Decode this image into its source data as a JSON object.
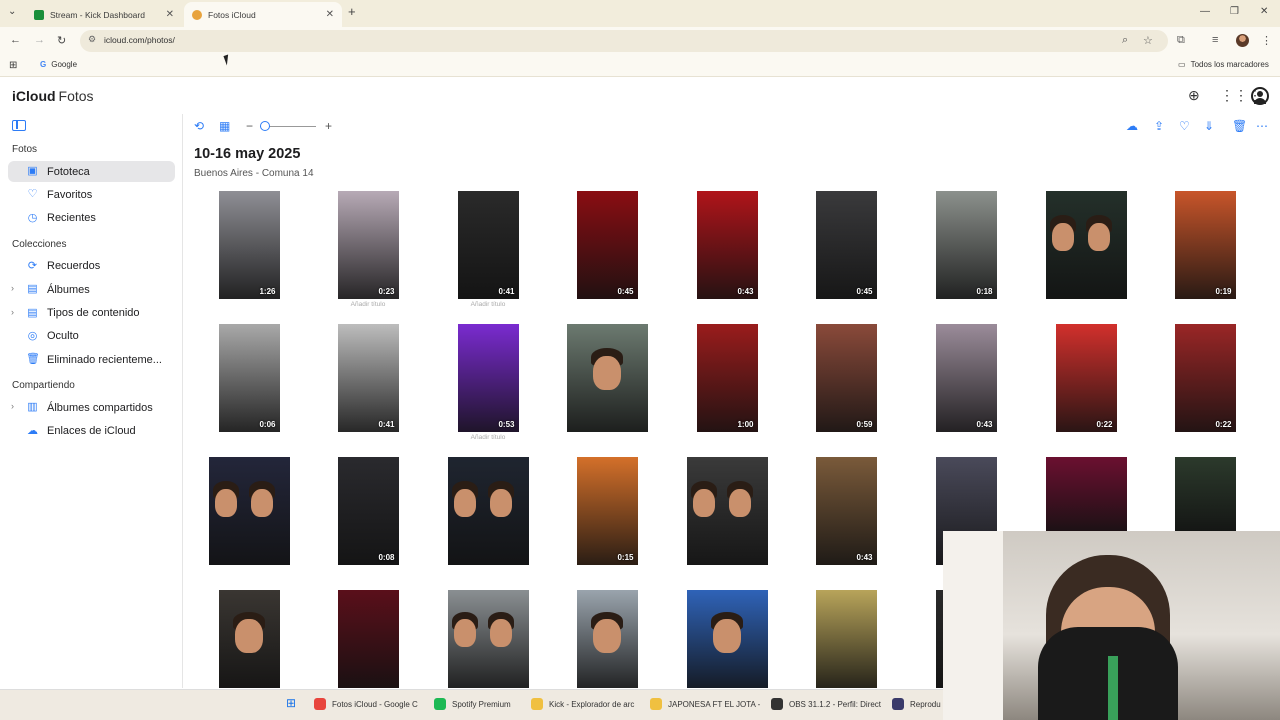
{
  "browser": {
    "tabs": [
      {
        "title": "Stream - Kick Dashboard",
        "favicon_color": "#1a8f3a",
        "active": false
      },
      {
        "title": "Fotos iCloud",
        "favicon_color": "#e8a33d",
        "active": true
      }
    ],
    "new_tab": "+",
    "url": "icloud.com/photos/",
    "bookmarks": {
      "google": "Google",
      "all": "Todos los marcadores"
    }
  },
  "app": {
    "brand": "iCloud",
    "product": "Fotos"
  },
  "sidebar": {
    "sections": [
      {
        "title": "Fotos",
        "items": [
          {
            "label": "Fototeca",
            "icon": "library-icon",
            "selected": true
          },
          {
            "label": "Favoritos",
            "icon": "heart-icon"
          },
          {
            "label": "Recientes",
            "icon": "clock-icon"
          }
        ]
      },
      {
        "title": "Colecciones",
        "items": [
          {
            "label": "Recuerdos",
            "icon": "memories-icon"
          },
          {
            "label": "Álbumes",
            "icon": "album-icon",
            "expandable": true
          },
          {
            "label": "Tipos de contenido",
            "icon": "album-icon",
            "expandable": true
          },
          {
            "label": "Oculto",
            "icon": "eye-off-icon"
          },
          {
            "label": "Eliminado recienteme...",
            "icon": "trash-icon"
          }
        ]
      },
      {
        "title": "Compartiendo",
        "items": [
          {
            "label": "Álbumes compartidos",
            "icon": "shared-album-icon",
            "expandable": true
          },
          {
            "label": "Enlaces de iCloud",
            "icon": "cloud-link-icon"
          }
        ]
      }
    ]
  },
  "main": {
    "date": "10-16 may 2025",
    "place": "Buenos Aires - Comuna 14",
    "add_title": "Añadir título",
    "rows": [
      [
        {
          "dur": "1:26",
          "tone": "#8f8f95"
        },
        {
          "dur": "0:23",
          "tone": "#b7aab6",
          "caption": true
        },
        {
          "dur": "0:41",
          "tone": "#2a2a2a",
          "caption": true
        },
        {
          "dur": "0:45",
          "tone": "#8a0d12"
        },
        {
          "dur": "0:43",
          "tone": "#b0141a"
        },
        {
          "dur": "0:45",
          "tone": "#3a3a3c"
        },
        {
          "dur": "0:18",
          "tone": "#8c918d"
        },
        {
          "dur": "",
          "tone": "#24302a",
          "wide": true,
          "faces": 2
        },
        {
          "dur": "0:19",
          "tone": "#c8552a"
        }
      ],
      [
        {
          "dur": "0:06",
          "tone": "#a9a9a9"
        },
        {
          "dur": "0:41",
          "tone": "#bdbdbd"
        },
        {
          "dur": "0:53",
          "tone": "#7a2bd0",
          "caption": true
        },
        {
          "dur": "",
          "tone": "#6c7a70",
          "wide": true,
          "faces": 1
        },
        {
          "dur": "1:00",
          "tone": "#9a1c1c"
        },
        {
          "dur": "0:59",
          "tone": "#8a4a3a"
        },
        {
          "dur": "0:43",
          "tone": "#9b8c9a"
        },
        {
          "dur": "0:22",
          "tone": "#d2302c"
        },
        {
          "dur": "0:22",
          "tone": "#9a2626"
        }
      ],
      [
        {
          "dur": "",
          "tone": "#23263a",
          "wide": true,
          "faces": 2
        },
        {
          "dur": "0:08",
          "tone": "#2a2a2e"
        },
        {
          "dur": "",
          "tone": "#1f2530",
          "wide": true,
          "faces": 2
        },
        {
          "dur": "0:15",
          "tone": "#d4702a"
        },
        {
          "dur": "",
          "tone": "#3a3a3a",
          "wide": true,
          "faces": 2
        },
        {
          "dur": "0:43",
          "tone": "#7a5a3a"
        },
        {
          "dur": "",
          "tone": "#4a4a5a"
        },
        {
          "dur": "",
          "tone": "#6b1030",
          "wide": true
        },
        {
          "dur": "",
          "tone": "#2c3a2c"
        }
      ],
      [
        {
          "dur": "",
          "tone": "#3a3632",
          "faces": 1
        },
        {
          "dur": "",
          "tone": "#5a0f1a"
        },
        {
          "dur": "",
          "tone": "#8a8f92",
          "wide": true,
          "faces": 2
        },
        {
          "dur": "",
          "tone": "#9aa4ad",
          "faces": 1
        },
        {
          "dur": "",
          "tone": "#2f63b8",
          "wide": true,
          "faces": 1
        },
        {
          "dur": "",
          "tone": "#b8a45a"
        },
        {
          "dur": "",
          "tone": "#2a2a2a"
        }
      ]
    ]
  },
  "taskbar": [
    {
      "label": "Fotos iCloud - Google C",
      "color": "#e8453c"
    },
    {
      "label": "Spotify Premium",
      "color": "#1db954"
    },
    {
      "label": "Kick - Explorador de arc",
      "color": "#f0c040"
    },
    {
      "label": "JAPONESA FT EL JOTA -",
      "color": "#f0c040"
    },
    {
      "label": "OBS 31.1.2 - Perfil: Direct",
      "color": "#333333"
    },
    {
      "label": "Reprodu",
      "color": "#3a3a6a"
    }
  ]
}
